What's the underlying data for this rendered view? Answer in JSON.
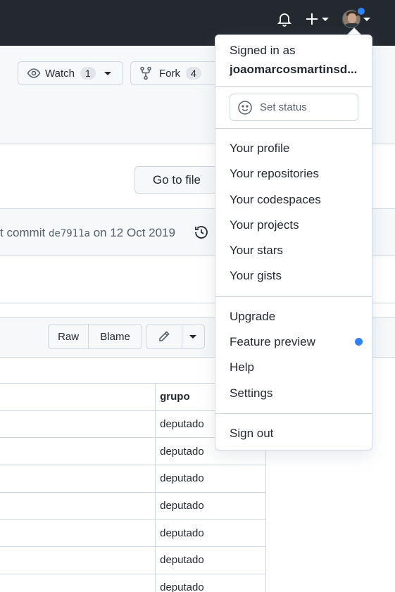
{
  "header": {
    "icons": {
      "bell": "bell-icon",
      "plus": "plus-icon",
      "avatar": "avatar"
    }
  },
  "repo": {
    "watch_label": "Watch",
    "watch_count": "1",
    "fork_label": "Fork",
    "fork_count": "4",
    "go_to_file": "Go to file"
  },
  "commit": {
    "prefix": "t commit",
    "sha": "de7911a",
    "date": "on 12 Oct 2019",
    "history_truncated": "l"
  },
  "file_actions": {
    "raw": "Raw",
    "blame": "Blame"
  },
  "table": {
    "column_header": "grupo",
    "rows": [
      "deputado",
      "deputado",
      "deputado",
      "deputado",
      "deputado",
      "deputado",
      "deputado"
    ]
  },
  "user_menu": {
    "signed_in_as": "Signed in as",
    "username": "joaomarcosmartinsd...",
    "set_status": "Set status",
    "items_group1": [
      "Your profile",
      "Your repositories",
      "Your codespaces",
      "Your projects",
      "Your stars",
      "Your gists"
    ],
    "items_group2": [
      "Upgrade",
      "Feature preview",
      "Help",
      "Settings"
    ],
    "sign_out": "Sign out"
  },
  "colors": {
    "header_bg": "#24292f",
    "accent_blue": "#2f81f7",
    "border": "#d0d7de",
    "subtle_bg": "#f6f8fa"
  }
}
